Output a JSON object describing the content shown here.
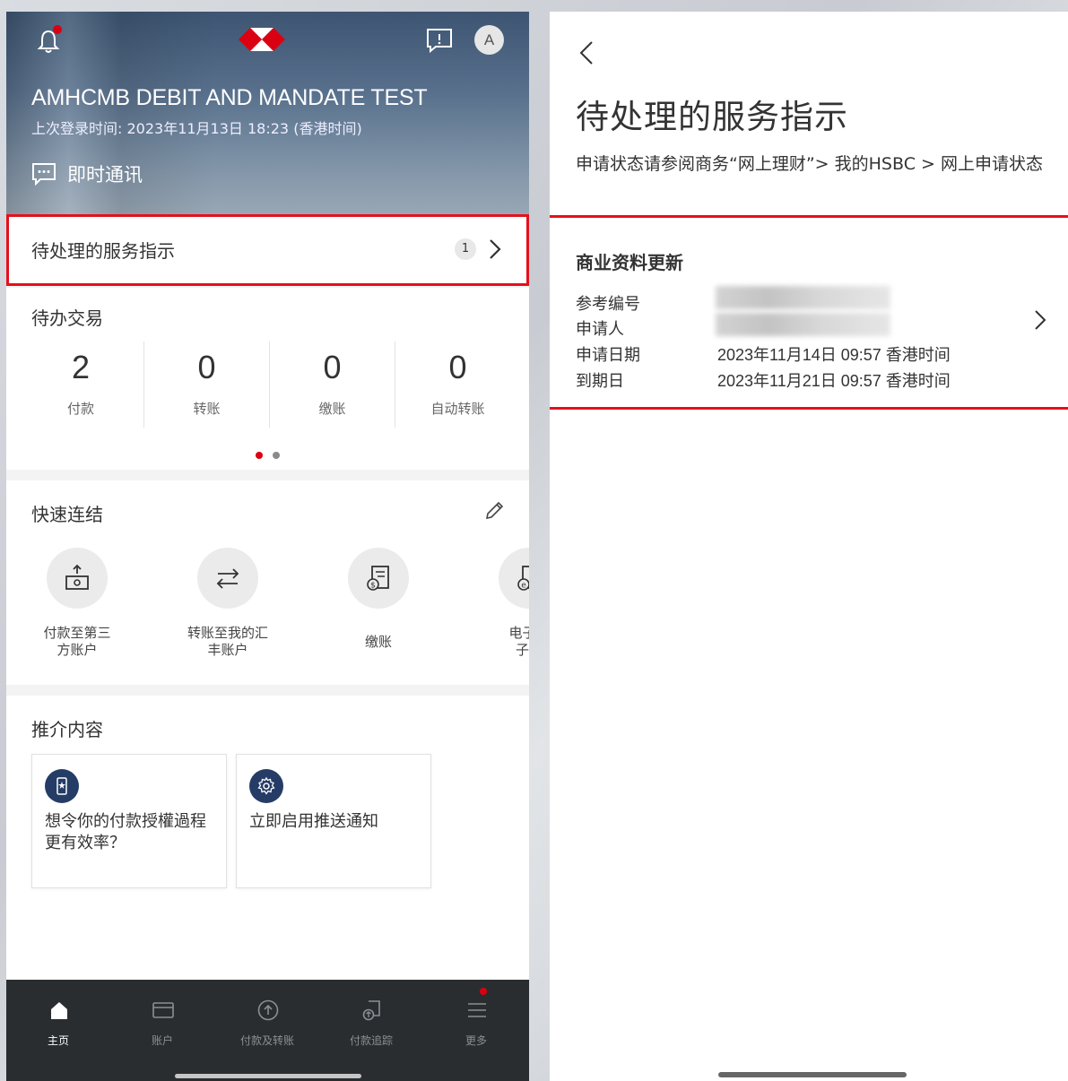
{
  "left": {
    "hero": {
      "account_name": "AMHCMB DEBIT AND MANDATE TEST",
      "last_login": "上次登录时间: 2023年11月13日 18:23 (香港时间)",
      "im_label": "即时通讯",
      "avatar_letter": "A",
      "icons": [
        "bell-icon",
        "hsbc-logo",
        "chat-alert-icon",
        "avatar"
      ]
    },
    "pending": {
      "title": "待处理的服务指示",
      "count": "1"
    },
    "todo": {
      "heading": "待办交易",
      "cells": [
        {
          "num": "2",
          "label": "付款"
        },
        {
          "num": "0",
          "label": "转账"
        },
        {
          "num": "0",
          "label": "缴账"
        },
        {
          "num": "0",
          "label": "自动转账"
        }
      ]
    },
    "quick": {
      "heading": "快速连结",
      "items": [
        {
          "label_line1": "付款至第三",
          "label_line2": "方账户",
          "icon": "pay-third-party-icon"
        },
        {
          "label_line1": "转账至我的汇",
          "label_line2": "丰账户",
          "icon": "transfer-icon"
        },
        {
          "label_line1": "缴账",
          "label_line2": "",
          "icon": "bill-icon"
        },
        {
          "label_line1": "电子结",
          "label_line2": "子通",
          "icon": "e-statement-icon"
        }
      ]
    },
    "recommend": {
      "heading": "推介内容",
      "cards": [
        {
          "text": "想令你的付款授權過程更有效率？",
          "icon": "phone-authorize-icon"
        },
        {
          "text": "立即启用推送通知",
          "icon": "gear-icon"
        }
      ]
    },
    "tabbar": {
      "tabs": [
        {
          "label": "主页",
          "icon": "home-icon",
          "active": true
        },
        {
          "label": "账户",
          "icon": "card-icon",
          "active": false
        },
        {
          "label": "付款及转账",
          "icon": "upload-circle-icon",
          "active": false
        },
        {
          "label": "付款追踪",
          "icon": "track-icon",
          "active": false
        },
        {
          "label": "更多",
          "icon": "menu-icon",
          "active": false
        }
      ]
    },
    "colors": {
      "accent_red": "#db0011",
      "highlight_red": "#e5101c",
      "tabbar_bg": "#2a2d30",
      "icon_navy": "#253c66"
    }
  },
  "right": {
    "title": "待处理的服务指示",
    "description": "申请状态请参阅商务“网上理财”> 我的HSBC > 网上申请状态",
    "request": {
      "title": "商业资料更新",
      "ref_label": "参考编号",
      "applicant_label": "申请人",
      "apply_date_label": "申请日期",
      "apply_date_value": "2023年11月14日 09:57 香港时间",
      "expiry_label": "到期日",
      "expiry_value": "2023年11月21日 09:57 香港时间"
    }
  }
}
